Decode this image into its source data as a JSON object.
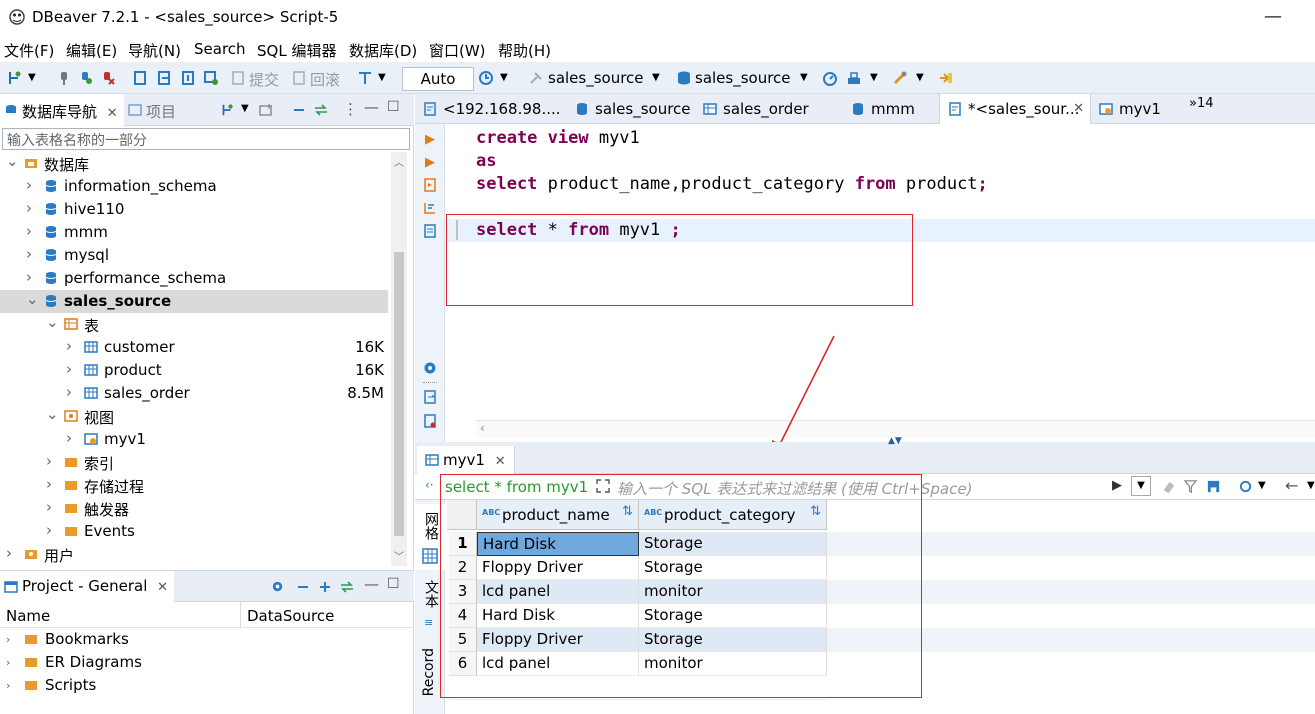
{
  "window": {
    "title": "DBeaver 7.2.1 - <sales_source> Script-5",
    "minimize": "—",
    "restore": "☐"
  },
  "menu": [
    "文件(F)",
    "编辑(E)",
    "导航(N)",
    "Search",
    "SQL 编辑器",
    "数据库(D)",
    "窗口(W)",
    "帮助(H)"
  ],
  "toolbar": {
    "commit": "提交",
    "rollback": "回滚",
    "auto": "Auto",
    "datasource": "sales_source",
    "schema": "sales_source"
  },
  "navigator": {
    "tab_label": "数据库导航",
    "tab2_label": "项目",
    "filter_placeholder": "输入表格名称的一部分",
    "tree": [
      {
        "label": "数据库",
        "level": 1,
        "expanded": true,
        "icon": "folder-db"
      },
      {
        "label": "information_schema",
        "level": 2,
        "icon": "db"
      },
      {
        "label": "hive110",
        "level": 2,
        "icon": "db"
      },
      {
        "label": "mmm",
        "level": 2,
        "icon": "db"
      },
      {
        "label": "mysql",
        "level": 2,
        "icon": "db"
      },
      {
        "label": "performance_schema",
        "level": 2,
        "icon": "db"
      },
      {
        "label": "sales_source",
        "level": 2,
        "icon": "db",
        "expanded": true,
        "selected": true
      },
      {
        "label": "表",
        "level": 3,
        "icon": "table-folder",
        "expanded": true
      },
      {
        "label": "customer",
        "level": 4,
        "icon": "table",
        "size": "16K"
      },
      {
        "label": "product",
        "level": 4,
        "icon": "table",
        "size": "16K"
      },
      {
        "label": "sales_order",
        "level": 4,
        "icon": "table",
        "size": "8.5M"
      },
      {
        "label": "视图",
        "level": 3,
        "icon": "view-folder",
        "expanded": true
      },
      {
        "label": "myv1",
        "level": 4,
        "icon": "view"
      },
      {
        "label": "索引",
        "level": 3,
        "icon": "folder"
      },
      {
        "label": "存储过程",
        "level": 3,
        "icon": "folder"
      },
      {
        "label": "触发器",
        "level": 3,
        "icon": "folder"
      },
      {
        "label": "Events",
        "level": 3,
        "icon": "folder"
      },
      {
        "label": "用户",
        "level": 1,
        "icon": "user-folder"
      }
    ]
  },
  "project": {
    "tab_label": "Project - General",
    "col_name": "Name",
    "col_datasource": "DataSource",
    "items": [
      "Bookmarks",
      "ER Diagrams",
      "Scripts"
    ]
  },
  "editor": {
    "tabs": [
      "<192.168.98....",
      "sales_source",
      "sales_order",
      "mmm",
      "*<sales_sour...",
      "myv1",
      "»14"
    ],
    "lines": [
      [
        {
          "t": "create view",
          "k": true
        },
        {
          "t": " myv1",
          "k": false
        }
      ],
      [
        {
          "t": "as",
          "k": true
        }
      ],
      [
        {
          "t": "select",
          "k": true
        },
        {
          "t": " product_name,product_category ",
          "k": false
        },
        {
          "t": "from",
          "k": true
        },
        {
          "t": " product",
          "k": false
        },
        {
          "t": ";",
          "k": true
        }
      ],
      [],
      [
        {
          "t": "select",
          "k": true
        },
        {
          "t": " * ",
          "k": false
        },
        {
          "t": "from",
          "k": true
        },
        {
          "t": " myv1 ",
          "k": false
        },
        {
          "t": ";",
          "k": true
        }
      ]
    ]
  },
  "results": {
    "tab_label": "myv1",
    "query_text": "select * from myv1",
    "filter_placeholder": "输入一个 SQL 表达式来过滤结果 (使用 Ctrl+Space)",
    "side_tabs": [
      "网格",
      "文本",
      "Record"
    ],
    "columns": [
      "product_name",
      "product_category"
    ],
    "rows": [
      [
        "1",
        "Hard Disk",
        "Storage"
      ],
      [
        "2",
        "Floppy Driver",
        "Storage"
      ],
      [
        "3",
        "lcd panel",
        "monitor"
      ],
      [
        "4",
        "Hard Disk",
        "Storage"
      ],
      [
        "5",
        "Floppy Driver",
        "Storage"
      ],
      [
        "6",
        "lcd panel",
        "monitor"
      ]
    ]
  },
  "colors": {
    "keyword": "#7f0055",
    "annotation": "#e0262b",
    "selected_cell": "#6fa8dc",
    "row_alt": "#dfe8f5"
  }
}
